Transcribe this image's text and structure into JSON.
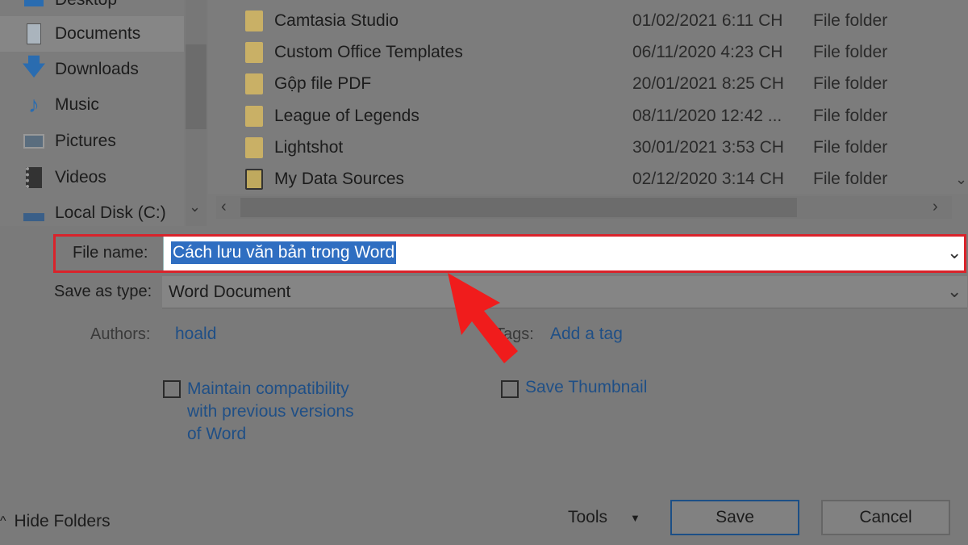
{
  "nav": {
    "items": [
      {
        "label": "Desktop",
        "icon": "desktop-icon"
      },
      {
        "label": "Documents",
        "icon": "documents-icon",
        "selected": true
      },
      {
        "label": "Downloads",
        "icon": "download-arrow-icon"
      },
      {
        "label": "Music",
        "icon": "music-note-icon"
      },
      {
        "label": "Pictures",
        "icon": "pictures-icon"
      },
      {
        "label": "Videos",
        "icon": "videos-icon"
      },
      {
        "label": "Local Disk (C:)",
        "icon": "local-disk-icon"
      }
    ]
  },
  "files": [
    {
      "name": "Camtasia Studio",
      "date": "01/02/2021 6:11 CH",
      "type": "File folder"
    },
    {
      "name": "Custom Office Templates",
      "date": "06/11/2020 4:23 CH",
      "type": "File folder"
    },
    {
      "name": "Gộp file PDF",
      "date": "20/01/2021 8:25 CH",
      "type": "File folder"
    },
    {
      "name": "League of Legends",
      "date": "08/11/2020 12:42 ...",
      "type": "File folder"
    },
    {
      "name": "Lightshot",
      "date": "30/01/2021 3:53 CH",
      "type": "File folder"
    },
    {
      "name": "My Data Sources",
      "date": "02/12/2020 3:14 CH",
      "type": "File folder"
    }
  ],
  "form": {
    "file_name_label": "File name:",
    "file_name_value": "Cách lưu văn bản trong Word",
    "save_type_label": "Save as type:",
    "save_type_value": "Word Document",
    "authors_label": "Authors:",
    "authors_value": "hoald",
    "tags_label": "Tags:",
    "tags_value": "Add a tag",
    "maintain_compat": "Maintain compatibility with previous versions of Word",
    "save_thumbnail": "Save Thumbnail"
  },
  "footer": {
    "hide_folders": "Hide Folders",
    "tools": "Tools",
    "save": "Save",
    "cancel": "Cancel"
  },
  "colors": {
    "highlight": "#d9232b",
    "arrow": "#f01c1c",
    "selection": "#2f6ec1",
    "link": "#1f4f86"
  }
}
